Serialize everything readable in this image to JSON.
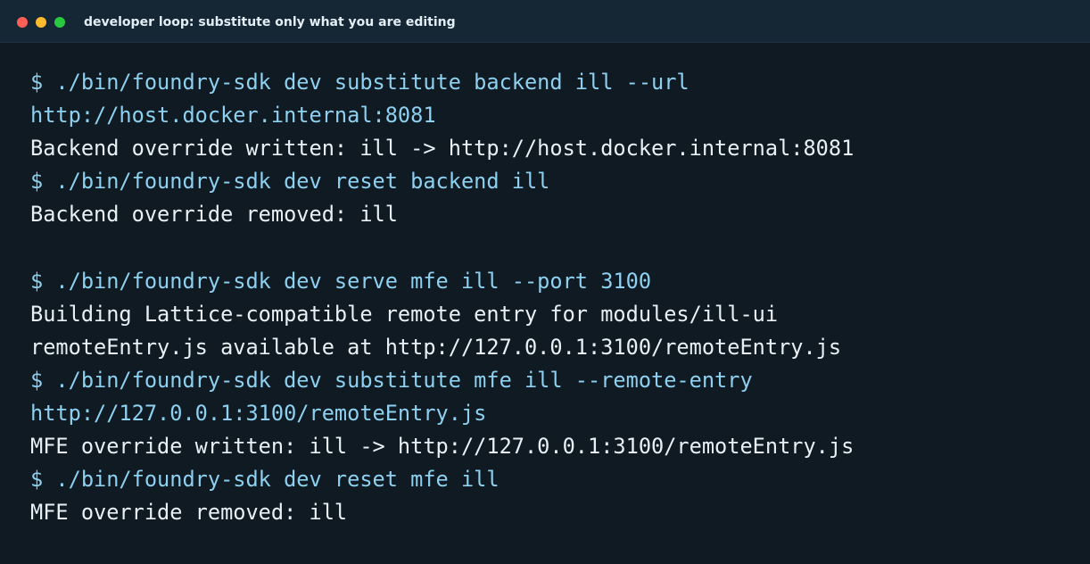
{
  "window": {
    "title": "developer loop: substitute only what you are editing"
  },
  "colors": {
    "background": "#0f1a22",
    "titlebar": "#152735",
    "command_text": "#8ed0f0",
    "output_text": "#e8f0f5",
    "close_dot": "#ff5f57",
    "minimize_dot": "#febc2e",
    "maximize_dot": "#28c840"
  },
  "terminal": {
    "lines": [
      {
        "kind": "cmd",
        "text": "$ ./bin/foundry-sdk dev substitute backend ill --url"
      },
      {
        "kind": "cmd",
        "text": "http://host.docker.internal:8081"
      },
      {
        "kind": "out",
        "text": "Backend override written: ill -> http://host.docker.internal:8081"
      },
      {
        "kind": "cmd",
        "text": "$ ./bin/foundry-sdk dev reset backend ill"
      },
      {
        "kind": "out",
        "text": "Backend override removed: ill"
      },
      {
        "kind": "blank",
        "text": ""
      },
      {
        "kind": "cmd",
        "text": "$ ./bin/foundry-sdk dev serve mfe ill --port 3100"
      },
      {
        "kind": "out",
        "text": "Building Lattice-compatible remote entry for modules/ill-ui"
      },
      {
        "kind": "out",
        "text": "remoteEntry.js available at http://127.0.0.1:3100/remoteEntry.js"
      },
      {
        "kind": "cmd",
        "text": "$ ./bin/foundry-sdk dev substitute mfe ill --remote-entry"
      },
      {
        "kind": "cmd",
        "text": "http://127.0.0.1:3100/remoteEntry.js"
      },
      {
        "kind": "out",
        "text": "MFE override written: ill -> http://127.0.0.1:3100/remoteEntry.js"
      },
      {
        "kind": "cmd",
        "text": "$ ./bin/foundry-sdk dev reset mfe ill"
      },
      {
        "kind": "out",
        "text": "MFE override removed: ill"
      }
    ]
  }
}
